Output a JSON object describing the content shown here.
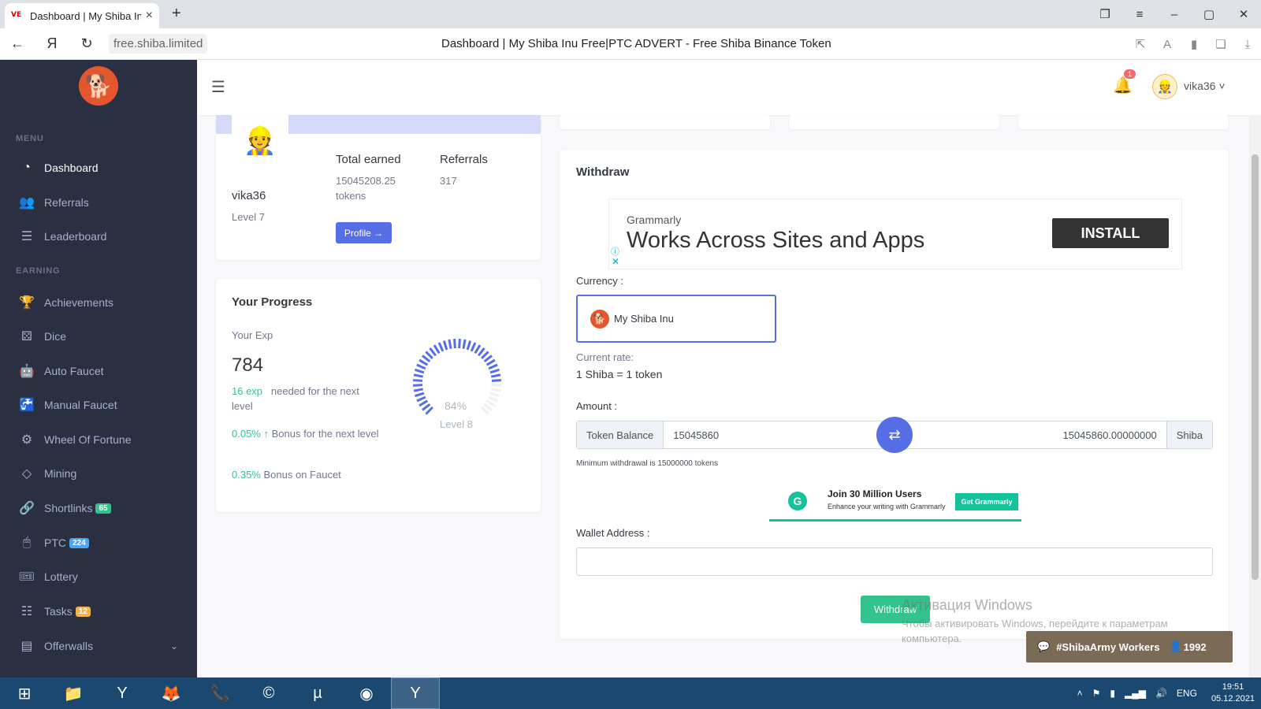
{
  "browser": {
    "tab_title": "Dashboard | My Shiba Inu Free",
    "tab_favicon": "VE",
    "url": "free.shiba.limited",
    "page_title": "Dashboard | My Shiba Inu Free|PTC ADVERT - Free Shiba Binance Token"
  },
  "sidebar": {
    "menu_title": "MENU",
    "earning_title": "EARNING",
    "items": [
      {
        "label": "Dashboard",
        "icon": "dashboard-icon",
        "active": true
      },
      {
        "label": "Referrals",
        "icon": "users-icon"
      },
      {
        "label": "Leaderboard",
        "icon": "list-icon"
      },
      {
        "label": "Achievements",
        "icon": "trophy-icon"
      },
      {
        "label": "Dice",
        "icon": "dice-icon"
      },
      {
        "label": "Auto Faucet",
        "icon": "robot-icon"
      },
      {
        "label": "Manual Faucet",
        "icon": "faucet-icon"
      },
      {
        "label": "Wheel Of Fortune",
        "icon": "wheel-icon"
      },
      {
        "label": "Mining",
        "icon": "diamond-icon"
      },
      {
        "label": "Shortlinks",
        "icon": "link-icon",
        "badge": "65",
        "badge_color": "#34c38f"
      },
      {
        "label": "PTC",
        "icon": "mouse-icon",
        "badge": "224",
        "badge_color": "#50a5f1"
      },
      {
        "label": "Lottery",
        "icon": "ticket-icon"
      },
      {
        "label": "Tasks",
        "icon": "tasks-icon",
        "badge": "12",
        "badge_color": "#f1b44c"
      },
      {
        "label": "Offerwalls",
        "icon": "offerwall-icon"
      }
    ]
  },
  "header": {
    "notifications_count": "1",
    "username": "vika36"
  },
  "profile": {
    "username": "vika36",
    "level": "Level 7",
    "total_earned_label": "Total earned",
    "total_earned_value": "15045208.25",
    "total_earned_unit": "tokens",
    "referrals_label": "Referrals",
    "referrals_value": "317",
    "profile_button": "Profile"
  },
  "progress": {
    "title": "Your Progress",
    "exp_label": "Your Exp",
    "exp_value": "784",
    "needed_value": "16 exp",
    "needed_text": "needed for the next level",
    "bonus_next_value": "0.05%",
    "bonus_next_text": "Bonus for the next level",
    "bonus_faucet_value": "0.35%",
    "bonus_faucet_text": "Bonus on Faucet",
    "gauge_percent": "84%",
    "gauge_fraction": 0.84,
    "gauge_level": "Level 8"
  },
  "withdraw": {
    "title": "Withdraw",
    "ad_brand": "Grammarly",
    "ad_headline": "Works Across Sites and Apps",
    "ad_button": "INSTALL",
    "currency_label": "Currency :",
    "currency_value": "My Shiba Inu",
    "rate_label": "Current rate:",
    "rate_value": "1 Shiba = 1 token",
    "amount_label": "Amount :",
    "token_balance_label": "Token Balance",
    "token_amount": "15045860",
    "shiba_amount": "15045860.00000000",
    "shiba_label": "Shiba",
    "minimum_note": "Minimum withdrawal is 15000000 tokens",
    "ad2_title": "Join 30 Million Users",
    "ad2_sub": "Enhance your writing with Grammarly",
    "ad2_button": "Get Grammarly",
    "wallet_label": "Wallet Address :",
    "wallet_value": "",
    "withdraw_button": "Withdraw"
  },
  "overlay": {
    "activation_title": "Активация Windows",
    "activation_text": "Чтобы активировать Windows, перейдите к параметрам компьютера.",
    "army_label": "#ShibaArmy Workers",
    "army_count": "1992"
  },
  "taskbar": {
    "lang": "ENG",
    "time": "19:51",
    "date": "05.12.2021"
  }
}
